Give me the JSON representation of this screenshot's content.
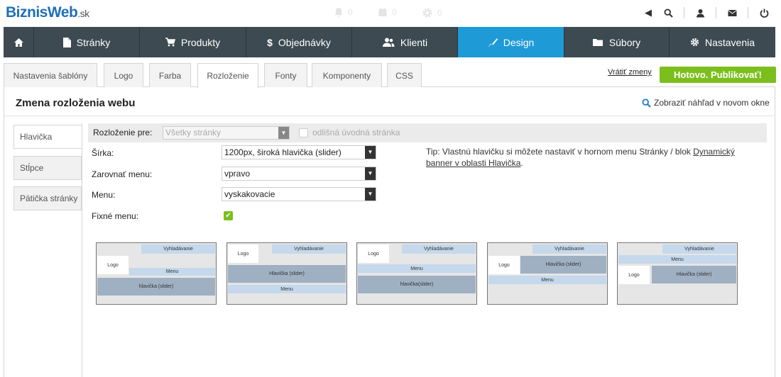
{
  "brand": {
    "name": "BiznisWeb",
    "suffix": ".sk"
  },
  "notifications": [
    {
      "icon": "bell-icon",
      "count": "0"
    },
    {
      "icon": "calendar-icon",
      "count": "0"
    },
    {
      "icon": "gear-icon",
      "count": "0"
    }
  ],
  "topbar_icons": [
    "caret-left-icon",
    "search-icon",
    "user-icon",
    "mail-icon",
    "power-icon"
  ],
  "nav": [
    {
      "label": "",
      "icon": "home-icon"
    },
    {
      "label": "Stránky",
      "icon": "page-icon"
    },
    {
      "label": "Produkty",
      "icon": "cart-icon"
    },
    {
      "label": "Objednávky",
      "icon": "dollar-icon"
    },
    {
      "label": "Klienti",
      "icon": "users-icon"
    },
    {
      "label": "Design",
      "icon": "brush-icon",
      "active": true
    },
    {
      "label": "Súbory",
      "icon": "folder-icon"
    },
    {
      "label": "Nastavenia",
      "icon": "cog-icon"
    }
  ],
  "subtabs": [
    "Nastavenia šablóny",
    "Logo",
    "Farba",
    "Rozloženie",
    "Fonty",
    "Komponenty",
    "CSS"
  ],
  "active_subtab": "Rozloženie",
  "actions": {
    "revert": "Vrátiť zmeny",
    "publish": "Hotovo. Publikovať!"
  },
  "page": {
    "title": "Zmena rozloženia webu",
    "preview": "Zobraziť náhľad v novom okne"
  },
  "sidebar": [
    "Hlavička",
    "Stĺpce",
    "Pätička stránky"
  ],
  "layout_for": {
    "label": "Rozloženie pre:",
    "value": "Všetky stránky",
    "checkbox_label": "odlišná úvodná stránka"
  },
  "fields": [
    {
      "label": "Šírka:",
      "value": "1200px, široká hlavička (slider)"
    },
    {
      "label": "Zarovnať menu:",
      "value": "vpravo"
    },
    {
      "label": "Menu:",
      "value": "vyskakovacie"
    },
    {
      "label": "Fixné menu:",
      "checked": true
    }
  ],
  "tip": {
    "text": "Tip: Vlastnú hlavičku si môžete nastaviť v hornom menu Stránky / blok ",
    "link": "Dynamický banner v oblasti Hlavička",
    "end": "."
  },
  "layouts": [
    {
      "search": "Vyhladávanie",
      "logo": "Logo",
      "menu": "Menu",
      "header": "hlavička (slider)"
    },
    {
      "search": "Vyhladávanie",
      "logo": "Logo",
      "menu": "Menu",
      "header": "Hlavička (slider)"
    },
    {
      "search": "Vyhladávanie",
      "logo": "Logo",
      "menu": "Menu",
      "header": "hlavička(slider)"
    },
    {
      "search": "Vyhladávanie",
      "logo": "Logo",
      "menu": "Menu",
      "header": "Hlavička (slider)"
    },
    {
      "search": "Vyhladávanie",
      "logo": "Logo",
      "menu": "Menu",
      "header": "Hlavička (slider)"
    }
  ],
  "colors": {
    "nav_bg": "#3d4a52",
    "nav_active": "#1e9ad6",
    "publish": "#7cbf1d",
    "brand": "#1f6fb8"
  }
}
